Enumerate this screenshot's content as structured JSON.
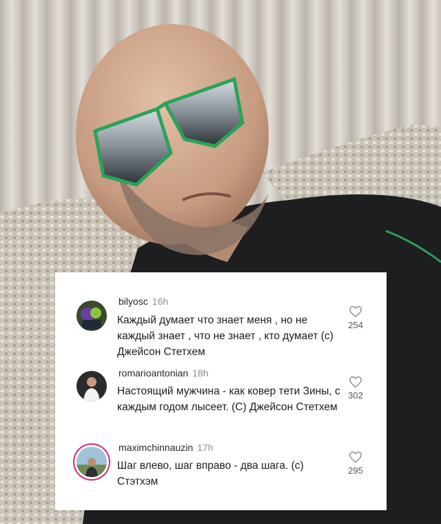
{
  "comments": [
    {
      "username": "bilyosc",
      "time": "16h",
      "text": "Каждый думает что знает меня , но не каждый знает , что не знает , кто думает (с) Джейсон Стетхем",
      "likes": "254",
      "avatar": "avatar-bilyosc"
    },
    {
      "username": "romarioantonian",
      "time": "18h",
      "text": "Настоящий мужчина - как ковер тети Зины, с каждым годом лысеет. (С) Джейсон Стетхем",
      "likes": "302",
      "avatar": "avatar-romarioantonian"
    },
    {
      "username": "maximchinnauzin",
      "time": "17h",
      "text": "Шаг влево, шаг вправо - два шага. (с) Стэтхэм",
      "likes": "295",
      "avatar": "avatar-maximchinnauzin-story-ring"
    }
  ],
  "icons": {
    "like": "heart-outline-icon"
  },
  "colors": {
    "username": "#262626",
    "time": "#8e8e8e",
    "story_ring": "#d62976"
  }
}
